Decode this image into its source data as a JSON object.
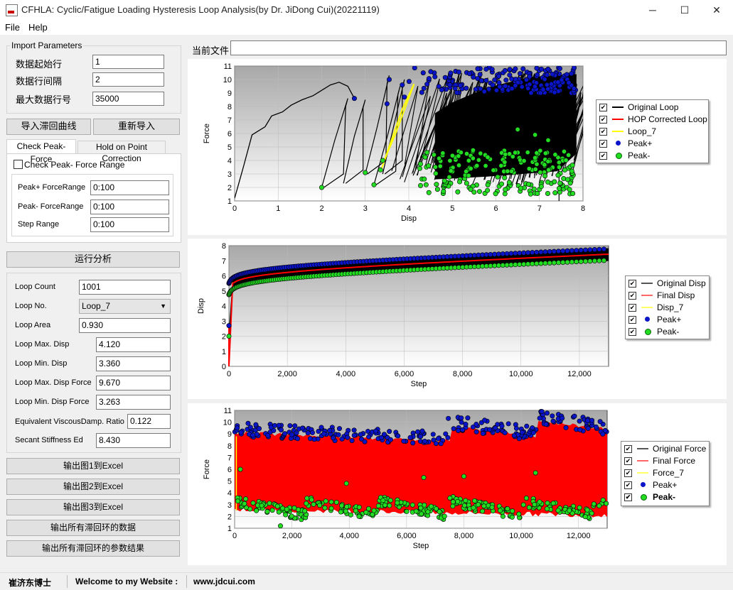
{
  "window": {
    "title": "CFHLA: Cyclic/Fatigue Loading Hysteresis Loop Analysis(by Dr. JiDong Cui)(20221119)",
    "icon": "app-logo-icon",
    "controls": {
      "minimize": "─",
      "maximize": "☐",
      "close": "✕"
    }
  },
  "menu": [
    "File",
    "Help"
  ],
  "import_params": {
    "legend": "Import Parameters",
    "fields": [
      {
        "label": "数据起始行",
        "value": "1"
      },
      {
        "label": "数据行间隔",
        "value": "2"
      },
      {
        "label": "最大数据行号",
        "value": "35000"
      }
    ]
  },
  "buttons": {
    "import_curve": "导入滞回曲线",
    "reimport": "重新导入",
    "run": "运行分析",
    "export": [
      "输出图1到Excel",
      "输出图2到Excel",
      "输出图3到Excel",
      "输出所有滞回环的数据",
      "输出所有滞回环的参数结果"
    ]
  },
  "tabs": [
    "Check Peak-Force",
    "Hold on Point Correction"
  ],
  "check_tab": {
    "checkbox_label": "Check Peak- Force Range",
    "fields": [
      {
        "label": "Peak+ ForceRange",
        "value": "0:100"
      },
      {
        "label": "Peak- ForceRange",
        "value": "0:100"
      },
      {
        "label": "Step Range",
        "value": "0:100"
      }
    ]
  },
  "results": {
    "loop_count_label": "Loop Count",
    "loop_count": "1001",
    "loop_no_label": "Loop No.",
    "loop_no": "Loop_7",
    "loop_area_label": "Loop Area",
    "loop_area": "0.930",
    "rows": [
      {
        "label": "Loop Max. Disp",
        "value": "4.120"
      },
      {
        "label": "Loop Min. Disp",
        "value": "3.360"
      },
      {
        "label": "Loop Max. Disp Force",
        "value": "9.670"
      },
      {
        "label": "Loop Min. Disp Force",
        "value": "3.263"
      }
    ],
    "evdr_label": "Equivalent ViscousDamp. Ratio",
    "evdr": "0.122",
    "secant_label": "Secant Stiffness Ed",
    "secant": "8.430"
  },
  "current_file": {
    "label": "当前文件",
    "value": ""
  },
  "colors": {
    "peak_plus": "#0a14c8",
    "peak_minus": "#22dd22",
    "corrected": "#ff0000",
    "loop": "#ffff00",
    "plot_top": "#a8a8a8",
    "plot_bottom": "#ffffff"
  },
  "chart_data": [
    {
      "type": "line",
      "xlabel": "Disp",
      "ylabel": "Force",
      "xlim": [
        0,
        8
      ],
      "ylim": [
        1,
        11
      ],
      "xticks": [
        "0",
        "1",
        "2",
        "3",
        "4",
        "5",
        "6",
        "7",
        "8"
      ],
      "yticks": [
        "1",
        "2",
        "3",
        "4",
        "5",
        "6",
        "7",
        "8",
        "9",
        "10",
        "11"
      ],
      "legend_position": "right",
      "series": [
        {
          "name": "Original Loop",
          "color": "#000000"
        },
        {
          "name": "HOP Corrected Loop",
          "color": "#ff0000"
        },
        {
          "name": "Loop_7",
          "color": "#ffff00"
        },
        {
          "name": "Peak+",
          "color": "#0a14c8"
        },
        {
          "name": "Peak-",
          "color": "#22dd22"
        }
      ]
    },
    {
      "type": "line",
      "xlabel": "Step",
      "ylabel": "Disp",
      "xlim": [
        0,
        13000
      ],
      "ylim": [
        0,
        8
      ],
      "xticks": [
        "0",
        "2,000",
        "4,000",
        "6,000",
        "8,000",
        "10,000",
        "12,000"
      ],
      "yticks": [
        "0",
        "1",
        "2",
        "3",
        "4",
        "5",
        "6",
        "7",
        "8"
      ],
      "legend_position": "right",
      "series": [
        {
          "name": "Original Disp",
          "color": "#555555"
        },
        {
          "name": "Final Disp",
          "color": "#ff0000"
        },
        {
          "name": "Disp_7",
          "color": "#ffff00"
        },
        {
          "name": "Peak+",
          "color": "#0a14c8"
        },
        {
          "name": "Peak-",
          "color": "#22dd22"
        }
      ]
    },
    {
      "type": "line",
      "xlabel": "Step",
      "ylabel": "Force",
      "xlim": [
        0,
        13000
      ],
      "ylim": [
        1,
        11
      ],
      "xticks": [
        "0",
        "2,000",
        "4,000",
        "6,000",
        "8,000",
        "10,000",
        "12,000"
      ],
      "yticks": [
        "1",
        "2",
        "3",
        "4",
        "5",
        "6",
        "7",
        "8",
        "9",
        "10",
        "11"
      ],
      "legend_position": "right",
      "series": [
        {
          "name": "Original Force",
          "color": "#555555"
        },
        {
          "name": "Final Force",
          "color": "#ff0000"
        },
        {
          "name": "Force_7",
          "color": "#ffff00"
        },
        {
          "name": "Peak+",
          "color": "#0a14c8"
        },
        {
          "name": "Peak-",
          "color": "#22dd22"
        }
      ]
    }
  ],
  "status": [
    "崔济东博士",
    "Welcome to my Website :",
    "www.jdcui.com"
  ]
}
